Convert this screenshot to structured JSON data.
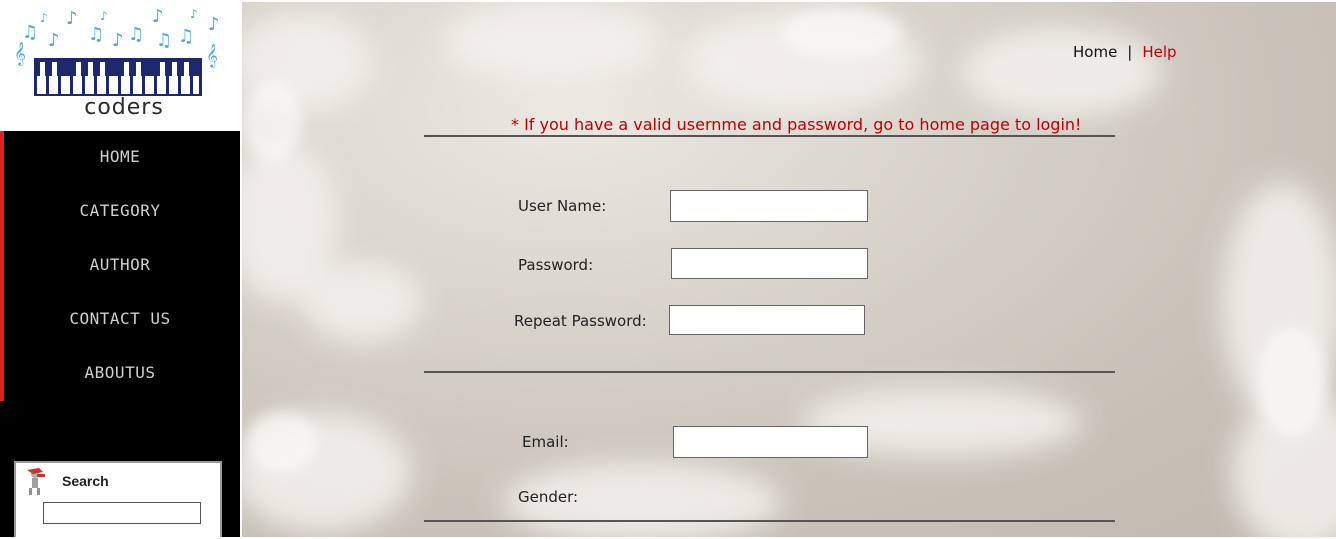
{
  "logo": {
    "text": "coders"
  },
  "nav": {
    "items": [
      "HOME",
      "CATEGORY",
      "AUTHOR",
      "CONTACT US",
      "ABOUTUS"
    ]
  },
  "search": {
    "label": "Search",
    "value": ""
  },
  "top_links": {
    "home": "Home",
    "separator": "|",
    "help": "Help"
  },
  "notice": "* If you have a valid usernme and password, go to home page to login!",
  "form": {
    "username_label": "User Name:",
    "username_value": "",
    "password_label": "Password:",
    "password_value": "",
    "repeat_password_label": "Repeat Password:",
    "repeat_password_value": "",
    "email_label": "Email:",
    "email_value": "",
    "gender_label": "Gender:"
  },
  "colors": {
    "sidebar_bg": "#000000",
    "nav_accent": "#e02020",
    "notice": "#c00000",
    "help_link": "#c00000"
  }
}
